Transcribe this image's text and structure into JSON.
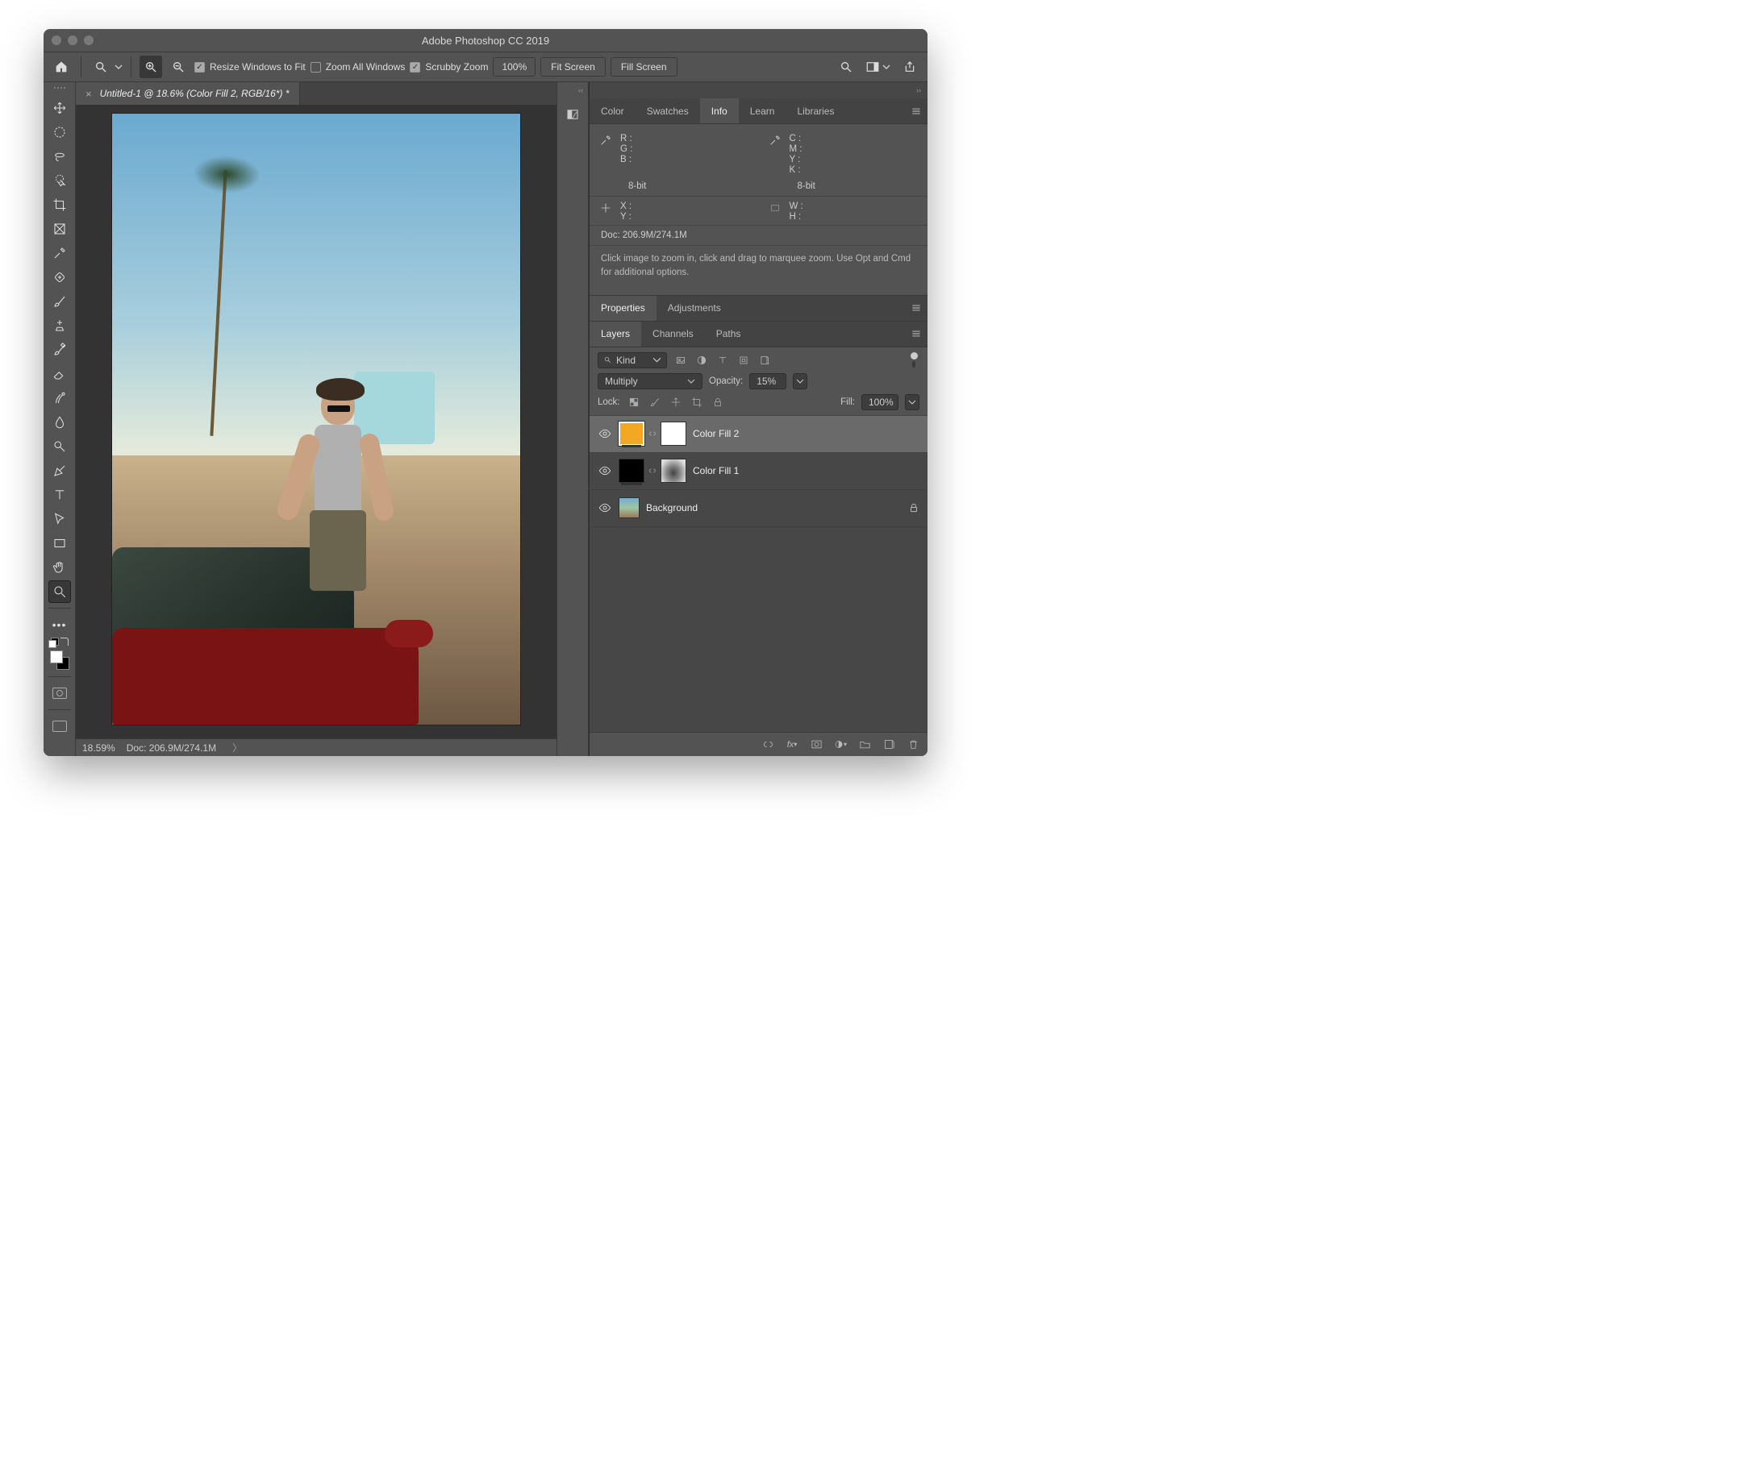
{
  "titlebar": {
    "title": "Adobe Photoshop CC 2019"
  },
  "optionsbar": {
    "resize_windows_label": "Resize Windows to Fit",
    "zoom_all_label": "Zoom All Windows",
    "scrubby_label": "Scrubby Zoom",
    "zoom_value": "100%",
    "fit_screen": "Fit Screen",
    "fill_screen": "Fill Screen"
  },
  "document": {
    "tab_title": "Untitled-1 @ 18.6% (Color Fill 2, RGB/16*) *",
    "status_zoom": "18.59%",
    "status_doc": "Doc: 206.9M/274.1M"
  },
  "panels": {
    "top_tabs": [
      "Color",
      "Swatches",
      "Info",
      "Learn",
      "Libraries"
    ],
    "top_active": "Info",
    "mid_tabs": [
      "Properties",
      "Adjustments"
    ],
    "mid_active": "Properties",
    "bot_tabs": [
      "Layers",
      "Channels",
      "Paths"
    ],
    "bot_active": "Layers"
  },
  "info": {
    "rgb": {
      "r": "R :",
      "g": "G :",
      "b": "B :"
    },
    "cmyk": {
      "c": "C :",
      "m": "M :",
      "y": "Y :",
      "k": "K :"
    },
    "bit1": "8-bit",
    "bit2": "8-bit",
    "pos": {
      "x": "X :",
      "y": "Y :"
    },
    "dim": {
      "w": "W :",
      "h": "H :"
    },
    "doc": "Doc: 206.9M/274.1M",
    "hint": "Click image to zoom in, click and drag to marquee zoom.  Use Opt and Cmd for additional options."
  },
  "layers": {
    "kind_label": "Kind",
    "blend_mode": "Multiply",
    "opacity_label": "Opacity:",
    "opacity_value": "15%",
    "lock_label": "Lock:",
    "fill_label": "Fill:",
    "fill_value": "100%",
    "items": [
      {
        "name": "Color Fill 2"
      },
      {
        "name": "Color Fill 1"
      },
      {
        "name": "Background"
      }
    ],
    "fx_label": "fx"
  }
}
